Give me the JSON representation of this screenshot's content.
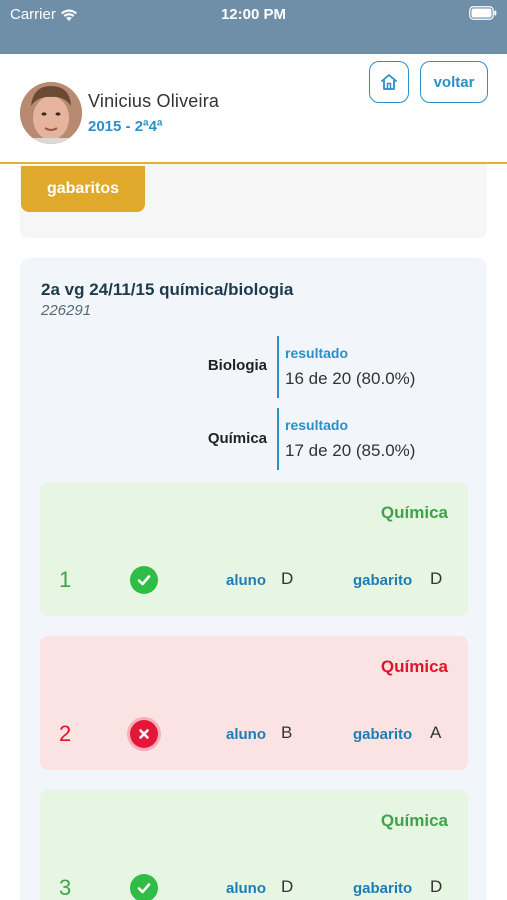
{
  "status_bar": {
    "carrier": "Carrier",
    "time": "12:00 PM"
  },
  "header": {
    "user_name": "Vinicius Oliveira",
    "user_class": "2015 - 2ª4ª",
    "back_label": "voltar"
  },
  "gabaritos_label": "gabaritos",
  "exam": {
    "title": "2a vg 24/11/15  química/biologia",
    "code": "226291",
    "results": [
      {
        "subject": "Biologia",
        "label": "resultado",
        "value": "16 de 20 (80.0%)"
      },
      {
        "subject": "Química",
        "label": "resultado",
        "value": "17 de 20 (85.0%)"
      }
    ]
  },
  "questions": [
    {
      "number": "1",
      "subject": "Química",
      "correct": true,
      "aluno_label": "aluno",
      "aluno": "D",
      "gabarito_label": "gabarito",
      "gabarito": "D"
    },
    {
      "number": "2",
      "subject": "Química",
      "correct": false,
      "aluno_label": "aluno",
      "aluno": "B",
      "gabarito_label": "gabarito",
      "gabarito": "A"
    },
    {
      "number": "3",
      "subject": "Química",
      "correct": true,
      "aluno_label": "aluno",
      "aluno": "D",
      "gabarito_label": "gabarito",
      "gabarito": "D"
    }
  ],
  "colors": {
    "status_bar": "#6f8ea7",
    "accent": "#2b8fc8",
    "gabaritos_button": "#e0a92b",
    "correct": "#3ea34a",
    "wrong": "#e0142a"
  }
}
